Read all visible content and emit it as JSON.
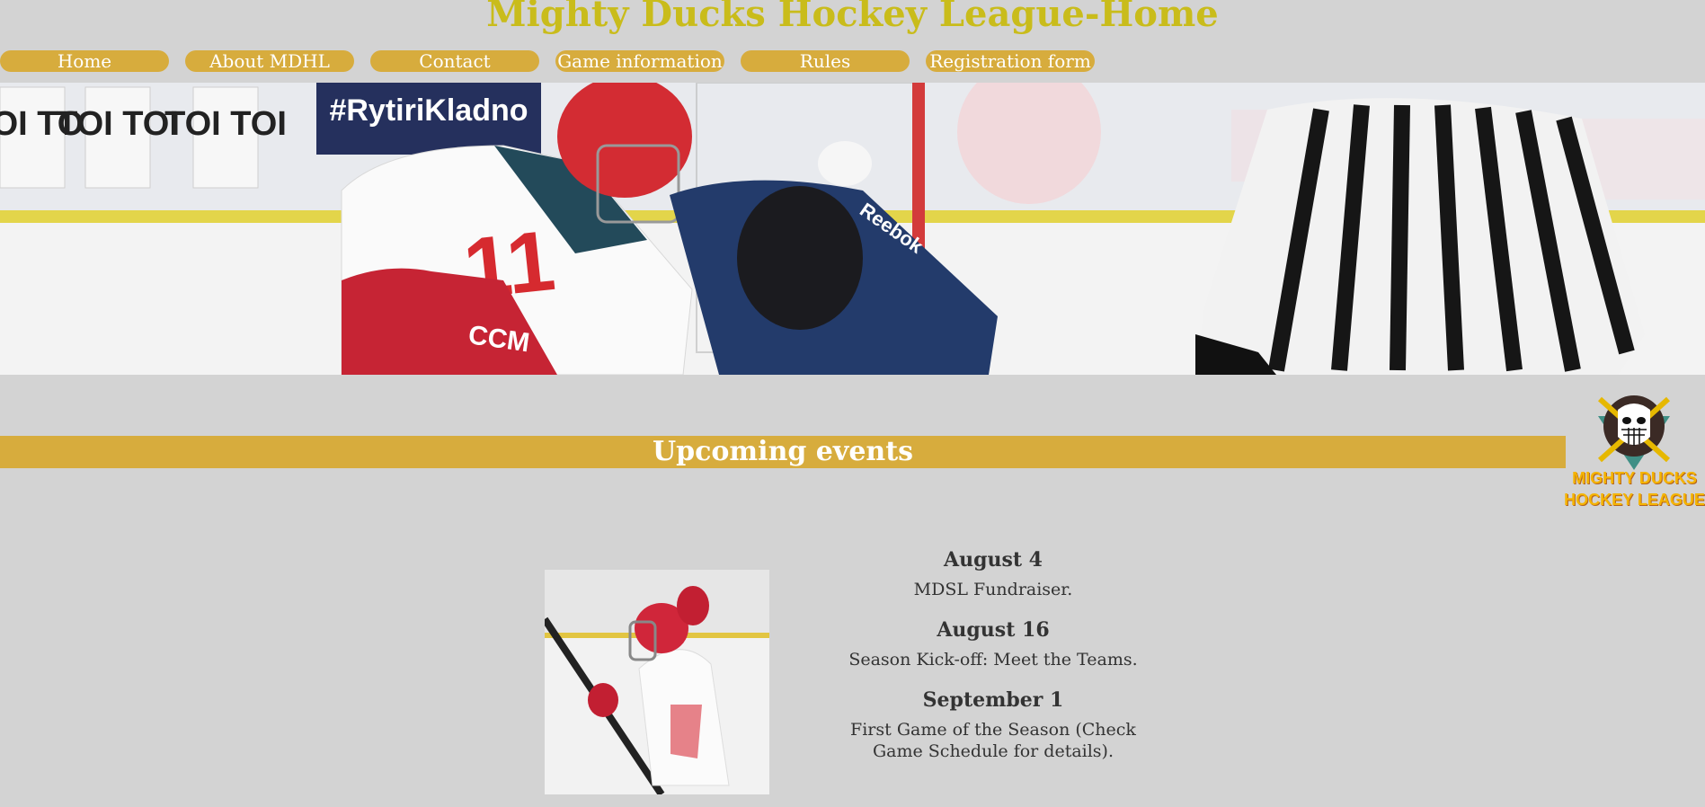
{
  "site": {
    "title": "Mighty Ducks Hockey League-Home"
  },
  "nav": {
    "items": [
      {
        "label": "Home"
      },
      {
        "label": "About MDHL"
      },
      {
        "label": "Contact"
      },
      {
        "label": "Game information"
      },
      {
        "label": "Rules"
      },
      {
        "label": "Registration form"
      }
    ]
  },
  "hero": {
    "banner_texts": [
      "TOI TOI",
      "TOI TOI",
      "TOI TOI",
      "#RytiriKladno",
      "11",
      "CCM",
      "Reebok"
    ]
  },
  "logo": {
    "line1": "MIGHTY DUCKS",
    "line2": "HOCKEY LEAGUE"
  },
  "events": {
    "heading": "Upcoming events",
    "items": [
      {
        "date": "August 4",
        "description": "MDSL Fundraiser."
      },
      {
        "date": "August 16",
        "description": "Season Kick-off: Meet the Teams."
      },
      {
        "date": "September 1",
        "description": "First Game of the Season (Check Game Schedule for details)."
      }
    ]
  },
  "colors": {
    "background": "#d3d3d3",
    "accent": "#d7ac3d",
    "title": "#c9bc1b",
    "nav_text": "#ffffff",
    "body_text": "#333333"
  }
}
